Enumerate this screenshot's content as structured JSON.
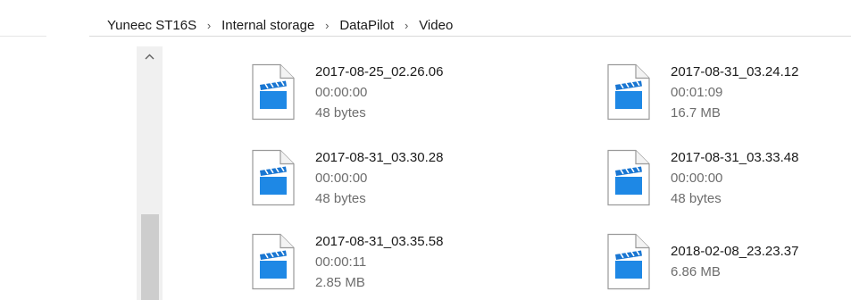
{
  "breadcrumb": [
    {
      "label": "Yuneec ST16S"
    },
    {
      "label": "Internal storage"
    },
    {
      "label": "DataPilot"
    },
    {
      "label": "Video"
    }
  ],
  "separator_glyph": "›",
  "scroll_up_glyph": "^",
  "files": [
    {
      "name": "2017-08-25_02.26.06",
      "duration": "00:00:00",
      "size": "48 bytes",
      "icon": "video-file-icon"
    },
    {
      "name": "2017-08-31_03.24.12",
      "duration": "00:01:09",
      "size": "16.7 MB",
      "icon": "video-file-icon"
    },
    {
      "name": "2017-08-31_03.30.28",
      "duration": "00:00:00",
      "size": "48 bytes",
      "icon": "video-file-icon"
    },
    {
      "name": "2017-08-31_03.33.48",
      "duration": "00:00:00",
      "size": "48 bytes",
      "icon": "video-file-icon"
    },
    {
      "name": "2017-08-31_03.35.58",
      "duration": "00:00:11",
      "size": "2.85 MB",
      "icon": "video-file-icon"
    },
    {
      "name": "2018-02-08_23.23.37",
      "duration": "",
      "size": "6.86 MB",
      "icon": "video-file-icon"
    }
  ],
  "colors": {
    "accent": "#1e88e5",
    "clapper": "#1976d2"
  }
}
